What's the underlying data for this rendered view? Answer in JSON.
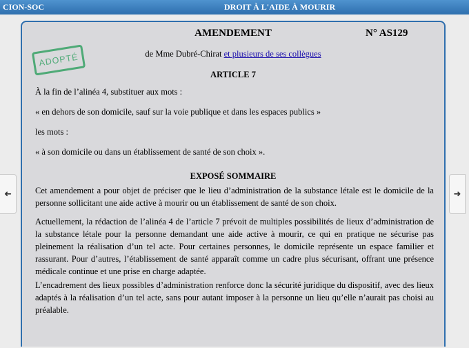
{
  "header": {
    "left": "CION-SOC",
    "title": "DROIT À L'AIDE À MOURIR"
  },
  "amendment": {
    "title": "AMENDEMENT",
    "number": "N° AS129",
    "authors_prefix": "de Mme Dubré-Chirat",
    "authors_link": "et plusieurs de ses collègues",
    "status_stamp": "ADOPTÉ",
    "stamp_color": "#4faa77",
    "article": "ARTICLE 7",
    "body": [
      "À la fin de l’alinéa 4, substituer aux mots :",
      "« en dehors de son domicile, sauf sur la voie publique et dans les espaces publics »",
      "les mots :",
      "« à son domicile ou dans un établissement de santé de son choix »."
    ],
    "expose_title": "EXPOSÉ SOMMAIRE",
    "expose": [
      "Cet amendement a pour objet de préciser que le lieu d’administration de la substance létale est le domicile de la personne sollicitant une aide active à mourir ou un établissement de santé de son choix.",
      "Actuellement, la rédaction de l’alinéa 4 de l’article 7 prévoit de multiples possibilités de lieux d’administration de la substance létale pour la personne demandant une aide active à mourir, ce qui en pratique ne sécurise pas pleinement la réalisation d’un tel acte. Pour certaines personnes, le domicile représente un espace familier et rassurant. Pour d’autres, l’établissement de santé apparaît comme un cadre plus sécurisant, offrant une présence médicale continue et une prise en charge adaptée.",
      "L’encadrement des lieux possibles d’administration renforce donc la sécurité juridique du dispositif, avec des lieux adaptés à la réalisation d’un tel acte, sans pour autant imposer à la personne un lieu qu’elle n’aurait pas choisi au préalable."
    ]
  },
  "nav": {
    "prev_icon": "arrow-left-icon",
    "next_icon": "arrow-right-icon",
    "prev_glyph": "➜",
    "next_glyph": "➜"
  }
}
